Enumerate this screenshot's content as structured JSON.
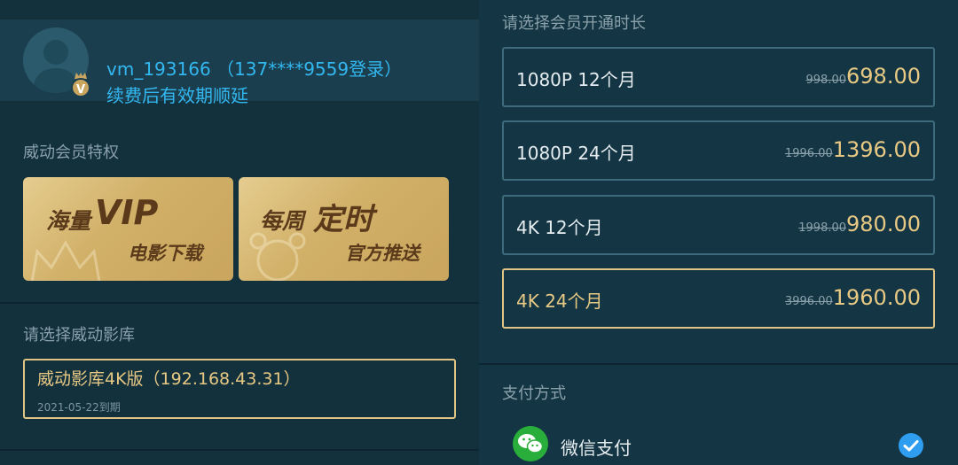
{
  "user": {
    "account_line": "vm_193166 （137****9559登录）",
    "status": "续费后有效期顺延",
    "badge": "V"
  },
  "privileges": {
    "title": "威动会员特权",
    "cards": [
      {
        "line1a": "海量",
        "line1b": "VIP",
        "line2": "电影下载"
      },
      {
        "line1a": "每周",
        "line1b": "定时",
        "line2": "官方推送"
      }
    ]
  },
  "library": {
    "title": "请选择威动影库",
    "name": "威动影库4K版（192.168.43.31）",
    "expiry": "2021-05-22到期"
  },
  "membership": {
    "title": "请选择会员开通时长",
    "plans": [
      {
        "label": "1080P 12个月",
        "original": "998.00",
        "price": "698.00",
        "selected": false
      },
      {
        "label": "1080P 24个月",
        "original": "1996.00",
        "price": "1396.00",
        "selected": false
      },
      {
        "label": "4K 12个月",
        "original": "1998.00",
        "price": "980.00",
        "selected": false
      },
      {
        "label": "4K 24个月",
        "original": "3996.00",
        "price": "1960.00",
        "selected": true
      }
    ]
  },
  "payment": {
    "title": "支付方式",
    "methods": [
      {
        "label": "微信支付",
        "icon": "wechat-icon",
        "checked": true
      }
    ]
  },
  "colors": {
    "accent_blue": "#33b7f0",
    "gold": "#e8c983",
    "background": "#13303d"
  }
}
